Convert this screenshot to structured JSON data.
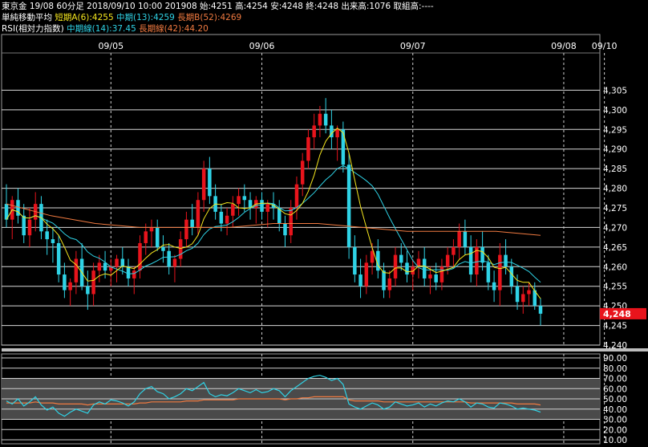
{
  "header": {
    "line1": "東京金 19/08 60分足 2018/09/10 10:00 201908 始:4251 高:4254 安:4248 終:4248 出来高:1076 取組高:----",
    "line2_label": "単純移動平均",
    "line2_short": "短期A(6):4255",
    "line2_mid": "中期(13):4259",
    "line2_long": "長期B(52):4269",
    "line3_label": "RSI(相対力指数)",
    "line3_mid": "中期線(14):37.45",
    "line3_long": "長期線(42):44.20"
  },
  "colors": {
    "up": "#e8141c",
    "down": "#2fd3e6",
    "ma_short": "#f5e61e",
    "ma_mid": "#2fd3e6",
    "ma_long": "#f07a40",
    "price_box": "#e8141c"
  },
  "chart_data": [
    {
      "type": "candlestick",
      "x_labels": [
        "09/05",
        "09/06",
        "09/07",
        "09/08",
        "09/10"
      ],
      "x_label_index": [
        18,
        44,
        70,
        96,
        103
      ],
      "ylim": [
        4240,
        4310
      ],
      "yticks": [
        4240,
        4245,
        4250,
        4255,
        4260,
        4265,
        4270,
        4275,
        4280,
        4285,
        4290,
        4295,
        4300,
        4305
      ],
      "ytick_labels": [
        "4,240",
        "4,245",
        "4,250",
        "4,255",
        "4,260",
        "4,265",
        "4,270",
        "4,275",
        "4,280",
        "4,285",
        "4,290",
        "4,295",
        "4,300",
        "4,305"
      ],
      "current_price": "4,248",
      "current_value": 4248,
      "ohlc": [
        [
          4276,
          4281,
          4270,
          4272
        ],
        [
          4272,
          4278,
          4267,
          4277
        ],
        [
          4277,
          4280,
          4271,
          4273
        ],
        [
          4273,
          4276,
          4266,
          4268
        ],
        [
          4268,
          4275,
          4265,
          4272
        ],
        [
          4272,
          4279,
          4269,
          4276
        ],
        [
          4276,
          4278,
          4267,
          4269
        ],
        [
          4269,
          4272,
          4263,
          4267
        ],
        [
          4267,
          4270,
          4261,
          4266
        ],
        [
          4266,
          4268,
          4256,
          4258
        ],
        [
          4258,
          4261,
          4252,
          4254
        ],
        [
          4254,
          4257,
          4250,
          4256
        ],
        [
          4256,
          4264,
          4253,
          4262
        ],
        [
          4262,
          4266,
          4254,
          4255
        ],
        [
          4255,
          4259,
          4249,
          4253
        ],
        [
          4253,
          4261,
          4250,
          4259
        ],
        [
          4259,
          4263,
          4256,
          4261
        ],
        [
          4261,
          4264,
          4257,
          4259
        ],
        [
          4259,
          4262,
          4255,
          4260
        ],
        [
          4260,
          4263,
          4256,
          4262
        ],
        [
          4262,
          4265,
          4258,
          4260
        ],
        [
          4260,
          4262,
          4255,
          4257
        ],
        [
          4257,
          4260,
          4253,
          4259
        ],
        [
          4259,
          4268,
          4257,
          4266
        ],
        [
          4266,
          4271,
          4263,
          4269
        ],
        [
          4269,
          4272,
          4265,
          4270
        ],
        [
          4270,
          4272,
          4264,
          4265
        ],
        [
          4265,
          4268,
          4261,
          4264
        ],
        [
          4264,
          4266,
          4258,
          4260
        ],
        [
          4260,
          4263,
          4256,
          4262
        ],
        [
          4262,
          4269,
          4260,
          4267
        ],
        [
          4267,
          4274,
          4265,
          4272
        ],
        [
          4272,
          4276,
          4268,
          4270
        ],
        [
          4270,
          4279,
          4268,
          4277
        ],
        [
          4277,
          4287,
          4274,
          4285
        ],
        [
          4285,
          4288,
          4276,
          4278
        ],
        [
          4278,
          4281,
          4272,
          4274
        ],
        [
          4274,
          4276,
          4269,
          4271
        ],
        [
          4271,
          4275,
          4268,
          4273
        ],
        [
          4273,
          4278,
          4270,
          4276
        ],
        [
          4276,
          4280,
          4273,
          4278
        ],
        [
          4278,
          4281,
          4274,
          4277
        ],
        [
          4277,
          4279,
          4272,
          4275
        ],
        [
          4275,
          4278,
          4271,
          4277
        ],
        [
          4277,
          4279,
          4272,
          4274
        ],
        [
          4274,
          4277,
          4270,
          4276
        ],
        [
          4276,
          4279,
          4272,
          4275
        ],
        [
          4275,
          4277,
          4269,
          4271
        ],
        [
          4271,
          4273,
          4265,
          4268
        ],
        [
          4268,
          4277,
          4266,
          4275
        ],
        [
          4275,
          4283,
          4272,
          4281
        ],
        [
          4281,
          4289,
          4278,
          4287
        ],
        [
          4287,
          4295,
          4285,
          4293
        ],
        [
          4293,
          4299,
          4290,
          4296
        ],
        [
          4296,
          4301,
          4293,
          4299
        ],
        [
          4299,
          4303,
          4294,
          4296
        ],
        [
          4296,
          4300,
          4290,
          4293
        ],
        [
          4293,
          4296,
          4287,
          4295
        ],
        [
          4295,
          4297,
          4284,
          4286
        ],
        [
          4286,
          4289,
          4262,
          4265
        ],
        [
          4265,
          4268,
          4256,
          4258
        ],
        [
          4258,
          4262,
          4252,
          4255
        ],
        [
          4255,
          4263,
          4253,
          4261
        ],
        [
          4261,
          4266,
          4258,
          4264
        ],
        [
          4264,
          4267,
          4257,
          4259
        ],
        [
          4259,
          4261,
          4252,
          4254
        ],
        [
          4254,
          4259,
          4252,
          4257
        ],
        [
          4257,
          4265,
          4255,
          4263
        ],
        [
          4263,
          4266,
          4259,
          4261
        ],
        [
          4261,
          4264,
          4256,
          4258
        ],
        [
          4258,
          4262,
          4254,
          4260
        ],
        [
          4260,
          4264,
          4257,
          4262
        ],
        [
          4262,
          4265,
          4255,
          4257
        ],
        [
          4257,
          4260,
          4253,
          4258
        ],
        [
          4258,
          4261,
          4254,
          4256
        ],
        [
          4256,
          4262,
          4254,
          4260
        ],
        [
          4260,
          4265,
          4258,
          4263
        ],
        [
          4263,
          4267,
          4260,
          4265
        ],
        [
          4265,
          4271,
          4262,
          4269
        ],
        [
          4269,
          4272,
          4263,
          4265
        ],
        [
          4265,
          4268,
          4256,
          4258
        ],
        [
          4258,
          4267,
          4255,
          4265
        ],
        [
          4265,
          4269,
          4259,
          4261
        ],
        [
          4261,
          4263,
          4254,
          4256
        ],
        [
          4256,
          4259,
          4251,
          4254
        ],
        [
          4254,
          4266,
          4250,
          4263
        ],
        [
          4263,
          4267,
          4258,
          4260
        ],
        [
          4260,
          4262,
          4253,
          4255
        ],
        [
          4255,
          4258,
          4249,
          4251
        ],
        [
          4251,
          4255,
          4248,
          4253
        ],
        [
          4253,
          4256,
          4250,
          4254
        ],
        [
          4254,
          4256,
          4249,
          4250
        ],
        [
          4250,
          4252,
          4245,
          4248
        ]
      ],
      "ma_short_label": "短期A(6)",
      "ma_mid_label": "中期(13)",
      "ma_long_label": "長期B(52)",
      "ma_long": [
        [
          0,
          4276
        ],
        [
          10,
          4273
        ],
        [
          20,
          4271
        ],
        [
          30,
          4270
        ],
        [
          40,
          4270
        ],
        [
          50,
          4270
        ],
        [
          60,
          4271
        ],
        [
          70,
          4271
        ],
        [
          80,
          4270
        ],
        [
          90,
          4269
        ],
        [
          100,
          4269
        ],
        [
          110,
          4269
        ],
        [
          120,
          4268
        ]
      ]
    },
    {
      "type": "line",
      "title": "RSI(相対力指数)",
      "ylim": [
        10,
        90
      ],
      "yticks": [
        10,
        20,
        30,
        40,
        50,
        60,
        70,
        80,
        90
      ],
      "ytick_labels": [
        "10.00",
        "20.00",
        "30.00",
        "40.00",
        "50.00",
        "60.00",
        "70.00",
        "80.00",
        "90.00"
      ],
      "series": [
        {
          "name": "中期線(14)",
          "values": [
            48,
            45,
            50,
            43,
            47,
            52,
            44,
            39,
            42,
            36,
            33,
            37,
            40,
            38,
            36,
            44,
            47,
            45,
            49,
            48,
            46,
            43,
            47,
            55,
            60,
            62,
            57,
            55,
            50,
            52,
            55,
            60,
            58,
            62,
            66,
            55,
            52,
            54,
            53,
            56,
            60,
            58,
            56,
            59,
            56,
            57,
            60,
            58,
            52,
            58,
            62,
            66,
            70,
            72,
            73,
            71,
            68,
            70,
            64,
            45,
            42,
            40,
            43,
            46,
            44,
            40,
            42,
            47,
            45,
            43,
            44,
            46,
            42,
            45,
            43,
            46,
            48,
            47,
            50,
            47,
            42,
            46,
            45,
            42,
            41,
            46,
            45,
            43,
            40,
            41,
            40,
            39,
            37
          ]
        },
        {
          "name": "長期線(42)",
          "values": [
            46,
            46,
            46,
            46,
            46,
            47,
            46,
            46,
            46,
            45,
            45,
            45,
            45,
            45,
            44,
            45,
            45,
            45,
            45,
            45,
            45,
            45,
            45,
            46,
            46,
            47,
            47,
            47,
            47,
            47,
            47,
            48,
            48,
            48,
            49,
            49,
            49,
            49,
            49,
            49,
            50,
            50,
            50,
            50,
            50,
            50,
            50,
            50,
            49,
            50,
            50,
            51,
            51,
            52,
            52,
            52,
            52,
            52,
            52,
            49,
            48,
            48,
            48,
            48,
            48,
            47,
            47,
            47,
            47,
            47,
            47,
            47,
            47,
            47,
            47,
            47,
            47,
            47,
            47,
            47,
            46,
            46,
            46,
            46,
            46,
            46,
            46,
            46,
            45,
            45,
            45,
            45,
            44
          ]
        }
      ]
    }
  ]
}
